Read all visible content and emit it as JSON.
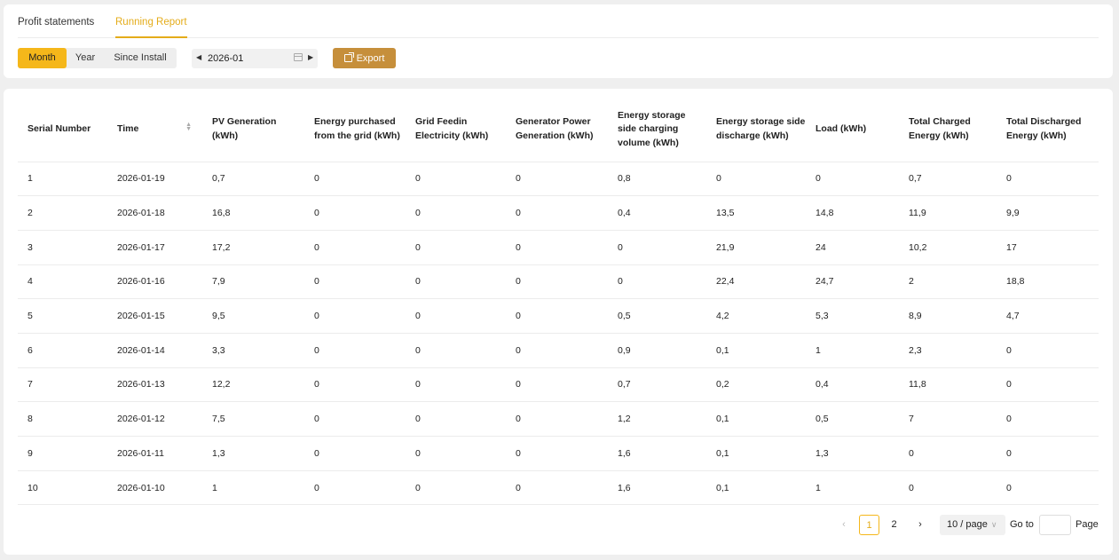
{
  "tabs": [
    {
      "label": "Profit statements",
      "active": false
    },
    {
      "label": "Running Report",
      "active": true
    }
  ],
  "period_buttons": [
    {
      "label": "Month",
      "active": true
    },
    {
      "label": "Year",
      "active": false
    },
    {
      "label": "Since Install",
      "active": false
    }
  ],
  "date_picker": {
    "value": "2026-01",
    "prev_icon": "caret-left-icon",
    "next_icon": "caret-right-icon",
    "calendar_icon": "calendar-icon"
  },
  "export": {
    "label": "Export",
    "icon": "export-icon"
  },
  "table": {
    "columns": [
      "Serial Number",
      "Time",
      "PV Generation (kWh)",
      "Energy purchased from the grid (kWh)",
      "Grid Feedin Electricity (kWh)",
      "Generator Power Generation (kWh)",
      "Energy storage side charging volume (kWh)",
      "Energy storage side discharge (kWh)",
      "Load (kWh)",
      "Total Charged Energy (kWh)",
      "Total Discharged Energy (kWh)"
    ],
    "rows": [
      [
        "1",
        "2026-01-19",
        "0,7",
        "0",
        "0",
        "0",
        "0,8",
        "0",
        "0",
        "0,7",
        "0"
      ],
      [
        "2",
        "2026-01-18",
        "16,8",
        "0",
        "0",
        "0",
        "0,4",
        "13,5",
        "14,8",
        "11,9",
        "9,9"
      ],
      [
        "3",
        "2026-01-17",
        "17,2",
        "0",
        "0",
        "0",
        "0",
        "21,9",
        "24",
        "10,2",
        "17"
      ],
      [
        "4",
        "2026-01-16",
        "7,9",
        "0",
        "0",
        "0",
        "0",
        "22,4",
        "24,7",
        "2",
        "18,8"
      ],
      [
        "5",
        "2026-01-15",
        "9,5",
        "0",
        "0",
        "0",
        "0,5",
        "4,2",
        "5,3",
        "8,9",
        "4,7"
      ],
      [
        "6",
        "2026-01-14",
        "3,3",
        "0",
        "0",
        "0",
        "0,9",
        "0,1",
        "1",
        "2,3",
        "0"
      ],
      [
        "7",
        "2026-01-13",
        "12,2",
        "0",
        "0",
        "0",
        "0,7",
        "0,2",
        "0,4",
        "11,8",
        "0"
      ],
      [
        "8",
        "2026-01-12",
        "7,5",
        "0",
        "0",
        "0",
        "1,2",
        "0,1",
        "0,5",
        "7",
        "0"
      ],
      [
        "9",
        "2026-01-11",
        "1,3",
        "0",
        "0",
        "0",
        "1,6",
        "0,1",
        "1,3",
        "0",
        "0"
      ],
      [
        "10",
        "2026-01-10",
        "1",
        "0",
        "0",
        "0",
        "1,6",
        "0,1",
        "1",
        "0",
        "0"
      ]
    ]
  },
  "pagination": {
    "prev": "‹",
    "pages": [
      "1",
      "2"
    ],
    "current_page": "1",
    "next": "›",
    "page_size": "10 / page",
    "goto_label": "Go to",
    "goto_value": "",
    "page_label": "Page"
  },
  "colors": {
    "accent": "#f5b71a",
    "accent_text": "#e4ac1a",
    "export_bg": "#c68f3b"
  }
}
